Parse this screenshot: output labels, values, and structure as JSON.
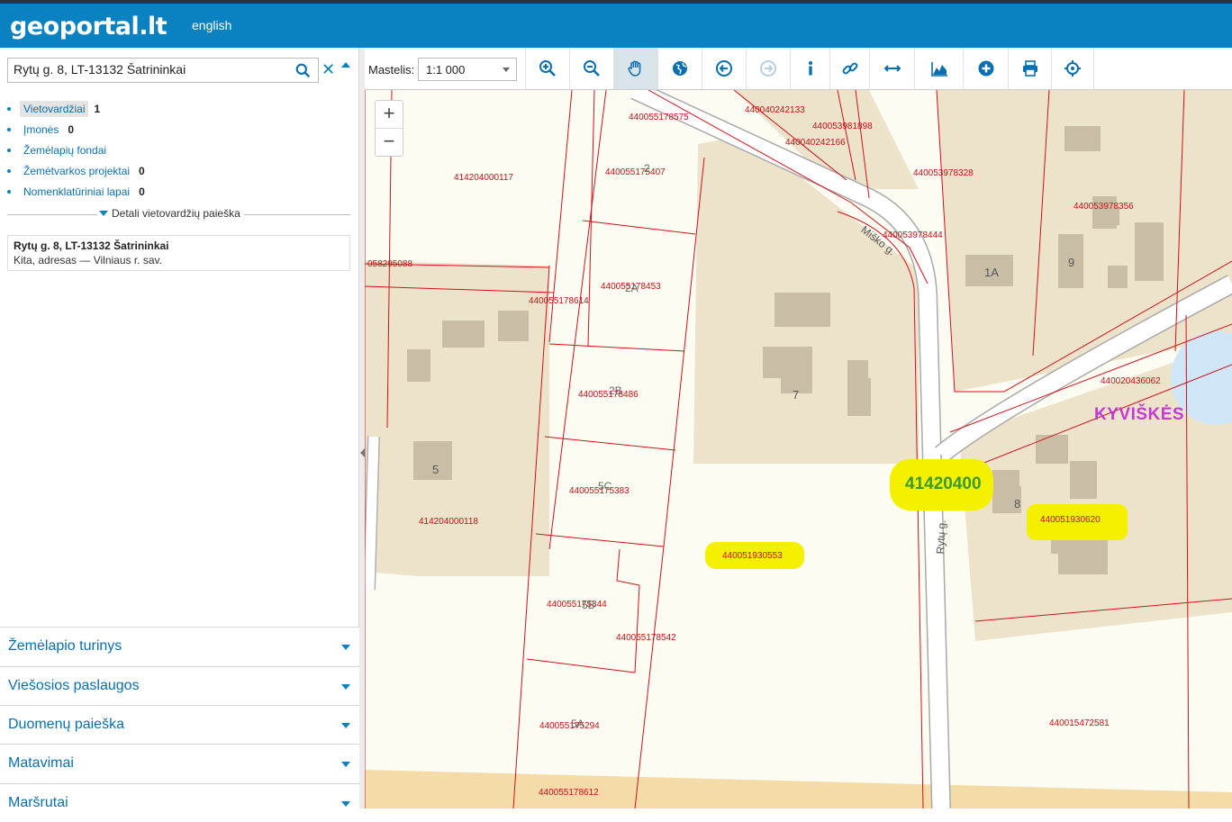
{
  "header": {
    "logo": "geoportal.lt",
    "language": "english"
  },
  "search": {
    "value": "Rytų g. 8, LT-13132 Šatrininkai"
  },
  "results": [
    {
      "label": "Vietovardžiai",
      "count": "1"
    },
    {
      "label": "Įmonės",
      "count": "0"
    },
    {
      "label": "Žemėlapių fondai",
      "count": ""
    },
    {
      "label": "Žemėtvarkos projektai",
      "count": "0"
    },
    {
      "label": "Nomenklatūriniai lapai",
      "count": "0"
    }
  ],
  "detail_search_label": "Detali vietovardžių paieška",
  "result_card": {
    "title": "Rytų g. 8, LT-13132 Šatrininkai",
    "subtitle": "Kita, adresas — Vilniaus r. sav."
  },
  "accordion": [
    "Žemėlapio turinys",
    "Viešosios paslaugos",
    "Duomenų paieška",
    "Matavimai",
    "Maršrutai"
  ],
  "toolbar": {
    "scale_label": "Mastelis:",
    "scale_value": "1:1 000",
    "tools": [
      "zoom-in",
      "zoom-out",
      "pan",
      "globe",
      "back",
      "forward",
      "info",
      "link",
      "measure",
      "profile",
      "add",
      "print",
      "locate"
    ]
  },
  "map": {
    "parcel_labels": [
      "440055178575",
      "440040242133",
      "440053981898",
      "440040242166",
      "440053978328",
      "414204000117",
      "440055175407",
      "440053978356",
      "440053978444",
      "058295088",
      "440055178453",
      "440055178614",
      "440055178486",
      "440020436062",
      "440055175383",
      "414204000118",
      "440051930553",
      "440051930620",
      "440055175344",
      "440055178542",
      "440055175294",
      "440015472581",
      "440055178612"
    ],
    "house_numbers": [
      "2",
      "2A",
      "2B",
      "5C",
      "5B",
      "5A",
      "5",
      "7",
      "1A",
      "9",
      "8"
    ],
    "street_labels": [
      "Miško g.",
      "Rytų g."
    ],
    "village_label": "KYVIŠKĖS",
    "highlight_label": "41420400"
  },
  "colors": {
    "header": "#0a82c1",
    "parcel_line": "#d4101a",
    "parcel_fill": "#ede3cb",
    "highlight": "#f5f000",
    "village": "#c43ad6"
  }
}
